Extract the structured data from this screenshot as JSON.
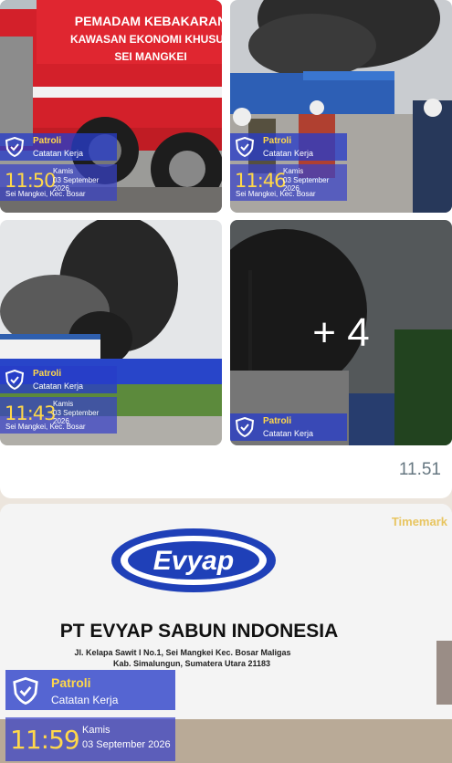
{
  "message1": {
    "time": "11.51",
    "more_count": "+ 4",
    "photos": [
      {
        "truck_text": [
          "PEMADAM KEBAKARAN",
          "KAWASAN EKONOMI KHUSUS",
          "SEI MANGKEI"
        ],
        "stamp": {
          "title": "Patroli",
          "subtitle": "Catatan Kerja",
          "clock": "11:50",
          "day": "Kamis",
          "date": "03 September 2026",
          "location": "Sei Mangkei, Kec. Bosar"
        }
      },
      {
        "stamp": {
          "title": "Patroli",
          "subtitle": "Catatan Kerja",
          "clock": "11:46",
          "day": "Kamis",
          "date": "03 September 2026",
          "location": "Sei Mangkei, Kec. Bosar"
        }
      },
      {
        "stamp": {
          "title": "Patroli",
          "subtitle": "Catatan Kerja",
          "clock": "11:43",
          "day": "Kamis",
          "date": "03 September 2026",
          "location": "Sei Mangkei, Kec. Bosar"
        }
      },
      {
        "stamp": {
          "title": "Patroli",
          "subtitle": "Catatan Kerja"
        }
      }
    ]
  },
  "message2": {
    "watermark_brand": "Timemark",
    "logo_text": "Evyap",
    "sign_title": "PT EVYAP SABUN INDONESIA",
    "sign_address_1": "Jl. Kelapa Sawit I No.1, Sei Mangkei Kec. Bosar Maligas",
    "sign_address_2": "Kab. Simalungun, Sumatera Utara 21183",
    "stamp": {
      "title": "Patroli",
      "subtitle": "Catatan Kerja",
      "clock": "11:59",
      "day": "Kamis",
      "date": "03 September 2026"
    }
  }
}
